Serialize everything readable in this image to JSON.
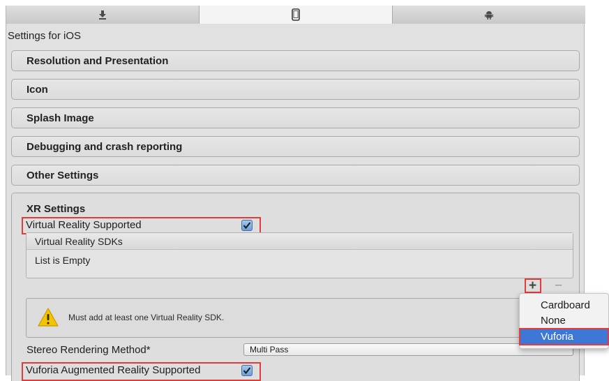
{
  "tabs": [
    {
      "icon": "download-icon",
      "active": false
    },
    {
      "icon": "phone-icon",
      "active": true
    },
    {
      "icon": "android-icon",
      "active": false
    }
  ],
  "settings_for": "Settings for iOS",
  "sections": [
    {
      "label": "Resolution and Presentation"
    },
    {
      "label": "Icon"
    },
    {
      "label": "Splash Image"
    },
    {
      "label": "Debugging and crash reporting"
    },
    {
      "label": "Other Settings"
    }
  ],
  "xr": {
    "title": "XR Settings",
    "vr_supported_label": "Virtual Reality Supported",
    "vr_supported_checked": true,
    "sdk_list": {
      "header": "Virtual Reality SDKs",
      "empty_text": "List is Empty",
      "add_label": "+",
      "remove_label": "−"
    },
    "warning_text": "Must add at least one Virtual Reality SDK.",
    "stereo_label": "Stereo Rendering Method*",
    "stereo_value": "Multi Pass",
    "vuforia_label": "Vuforia Augmented Reality Supported",
    "vuforia_checked": true
  },
  "popup_menu": {
    "items": [
      "Cardboard",
      "None",
      "Vuforia"
    ],
    "selected": "Vuforia"
  },
  "colors": {
    "highlight": "#e23b3b",
    "selection": "#3d78d7",
    "warning_icon": "#f5c400"
  }
}
